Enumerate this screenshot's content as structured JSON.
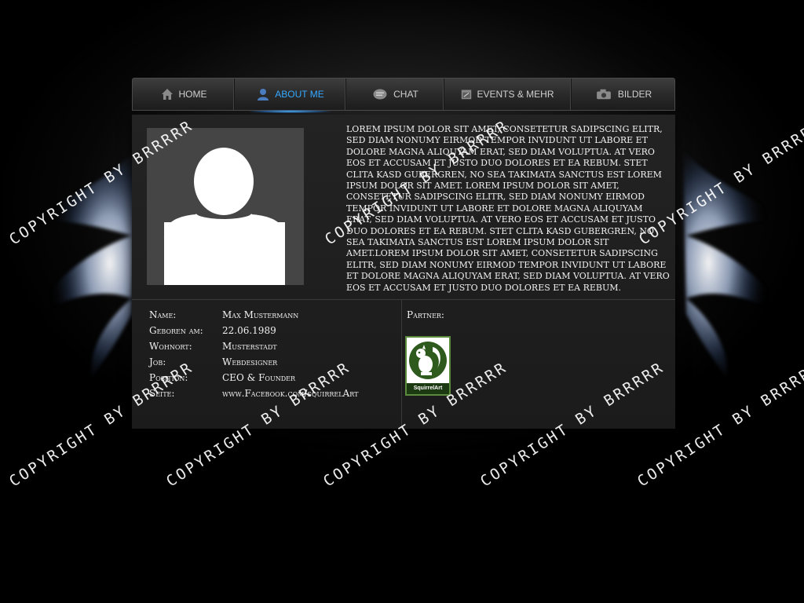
{
  "nav": {
    "items": [
      {
        "label": "Home",
        "icon": "home-icon",
        "active": false
      },
      {
        "label": "About me",
        "icon": "user-icon",
        "active": true
      },
      {
        "label": "Chat",
        "icon": "chat-icon",
        "active": false
      },
      {
        "label": "Events & Mehr",
        "icon": "calendar-icon",
        "active": false
      },
      {
        "label": "Bilder",
        "icon": "camera-icon",
        "active": false
      }
    ],
    "active_color": "#35a8ff"
  },
  "profile": {
    "bio": "Lorem ipsum dolor sit amet, consetetur sadipscing elitr, sed diam nonumy eirmod tempor invidunt ut labore et dolore magna aliquyam erat, sed diam voluptua. At vero eos et accusam et justo duo dolores et ea rebum. Stet clita kasd gubergren, no sea takimata sanctus est Lorem ipsum dolor sit amet. Lorem ipsum dolor sit amet, consetetur sadipscing elitr, sed diam nonumy eirmod tempor invidunt ut labore et dolore magna aliquyam erat, sed diam voluptua. At vero eos et accusam et justo duo dolores et ea rebum. Stet clita kasd gubergren, no sea takimata sanctus est Lorem ipsum dolor sit amet.Lorem ipsum dolor sit amet, consetetur sadipscing elitr, sed diam nonumy eirmod tempor invidunt ut labore et dolore magna aliquyam erat, sed diam voluptua. At vero eos et accusam et justo duo dolores et ea rebum.",
    "details": [
      {
        "label": "Name:",
        "value": "Max Mustermann"
      },
      {
        "label": "Geboren am:",
        "value": "22.06.1989"
      },
      {
        "label": "Wohnort:",
        "value": "Musterstadt"
      },
      {
        "label": "Job:",
        "value": "Webdesigner"
      },
      {
        "label": "Position:",
        "value": "CEO & Founder"
      },
      {
        "label": "Seite:",
        "value": "www.Facebook.com/squirrelArt"
      }
    ],
    "partner_label": "Partner:",
    "partner_logo_text": "SquirrelArt"
  },
  "watermark": {
    "text": "COPYRIGHT BY BRRRRR"
  },
  "colors": {
    "background": "#000000",
    "panel": "#1f1f1f",
    "text": "#f0f0f0",
    "accent": "#35a8ff",
    "logo_green": "#2e5a1e"
  }
}
